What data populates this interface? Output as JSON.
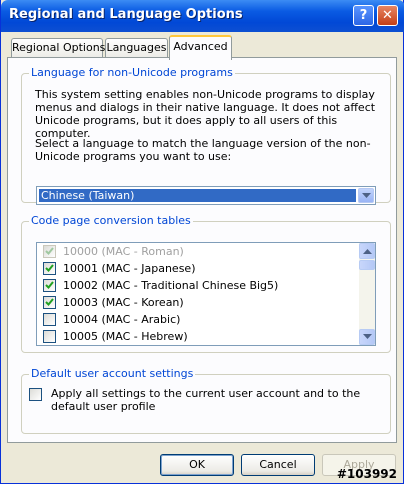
{
  "window": {
    "title": "Regional and Language Options",
    "help_button": "?",
    "close_button": "✕"
  },
  "tabs": [
    {
      "label": "Regional Options",
      "active": false
    },
    {
      "label": "Languages",
      "active": false
    },
    {
      "label": "Advanced",
      "active": true
    }
  ],
  "non_unicode": {
    "legend": "Language for non-Unicode programs",
    "description": "This system setting enables non-Unicode programs to display menus and dialogs in their native language. It does not affect Unicode programs, but it does apply to all users of this computer.",
    "prompt": "Select a language to match the language version of the non-Unicode programs you want to use:",
    "selected_language": "Chinese (Taiwan)"
  },
  "code_page": {
    "legend": "Code page conversion tables",
    "items": [
      {
        "label": "10000 (MAC - Roman)",
        "checked": true,
        "disabled": true
      },
      {
        "label": "10001 (MAC - Japanese)",
        "checked": true,
        "disabled": false
      },
      {
        "label": "10002 (MAC - Traditional Chinese Big5)",
        "checked": true,
        "disabled": false
      },
      {
        "label": "10003 (MAC - Korean)",
        "checked": true,
        "disabled": false
      },
      {
        "label": "10004 (MAC - Arabic)",
        "checked": false,
        "disabled": false
      },
      {
        "label": "10005 (MAC - Hebrew)",
        "checked": false,
        "disabled": false
      }
    ]
  },
  "default_user": {
    "legend": "Default user account settings",
    "checkbox_label": "Apply all settings to the current user account and to the default user profile",
    "checked": false
  },
  "buttons": {
    "ok": "OK",
    "cancel": "Cancel",
    "apply": "Apply"
  },
  "watermark": "#103992",
  "colors": {
    "titlebar": "#0A5BE3",
    "legend": "#0046D5",
    "selection": "#316AC5",
    "dialog_bg": "#ECE9D8"
  }
}
